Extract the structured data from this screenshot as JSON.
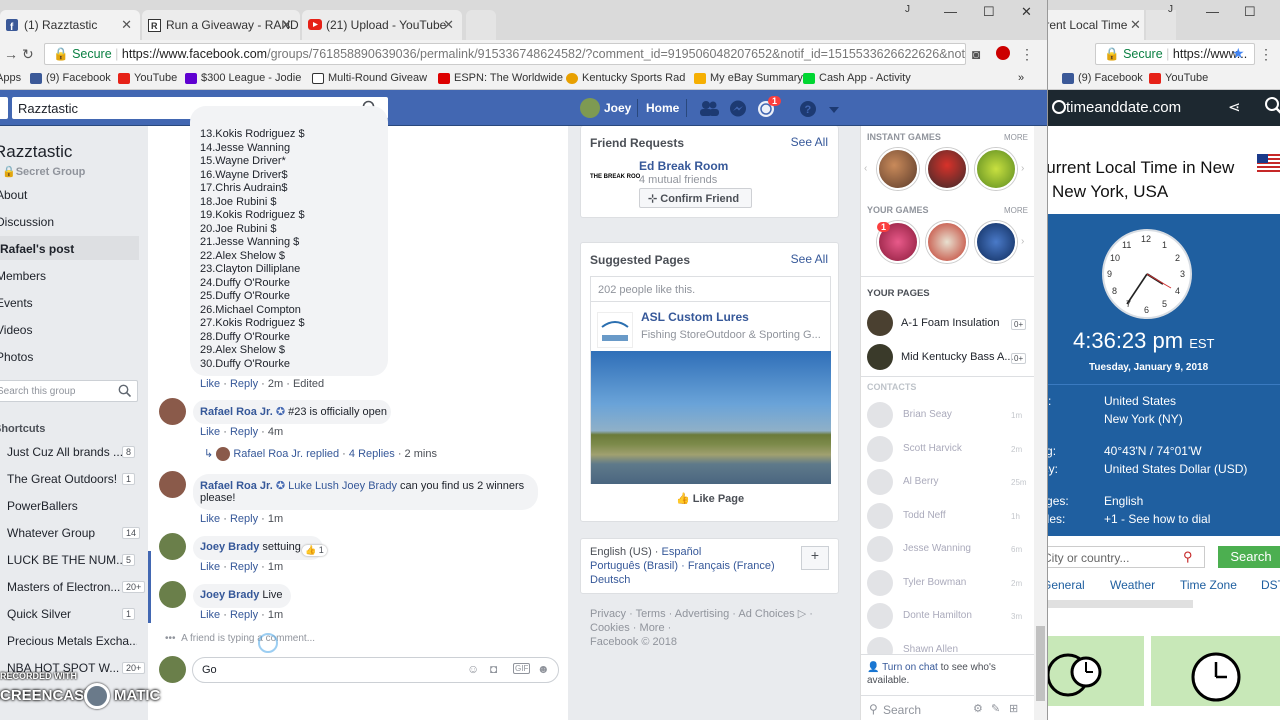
{
  "browser_left": {
    "tabs": [
      {
        "label": "(1) Razztastic",
        "icon": "facebook-icon"
      },
      {
        "label": "Run a Giveaway - RAND",
        "icon": "random-icon"
      },
      {
        "label": "(21) Upload - YouTube",
        "icon": "youtube-icon"
      }
    ],
    "address": {
      "secure_label": "Secure",
      "url_host": "https://www.facebook.com",
      "url_path": "/groups/761858890639036/permalink/915336748624582/?comment_id=919506048207652&notif_id=1515533626622626&notif_..."
    },
    "bookmarks": [
      "Apps",
      "(9) Facebook",
      "YouTube",
      "$300 League - Jodie",
      "Multi-Round Giveaw",
      "ESPN: The Worldwide",
      "Kentucky Sports Rad",
      "My eBay Summary",
      "Cash App - Activity"
    ],
    "more_bookmarks": "»"
  },
  "fb_header": {
    "search_value": "Razztastic",
    "user_name": "Joey",
    "home_label": "Home",
    "notif_count": "1"
  },
  "group_nav": {
    "group_name": "Razztastic",
    "group_type": "Secret Group",
    "items": [
      "About",
      "Discussion",
      "Rafael's post",
      "Members",
      "Events",
      "Videos",
      "Photos"
    ],
    "search_placeholder": "Search this group",
    "shortcuts_label": "Shortcuts",
    "shortcuts": [
      {
        "label": "Just Cuz All brands ...",
        "count": "8"
      },
      {
        "label": "The Great Outdoors!",
        "count": "1"
      },
      {
        "label": "PowerBallers",
        "count": ""
      },
      {
        "label": "Whatever Group",
        "count": "14"
      },
      {
        "label": "LUCK BE THE NUM...",
        "count": "5"
      },
      {
        "label": "Masters of Electron...",
        "count": "20+"
      },
      {
        "label": "Quick Silver",
        "count": "1"
      },
      {
        "label": "Precious Metals Excha...",
        "count": ""
      },
      {
        "label": "NBA HOT SPOT W...",
        "count": "20+"
      }
    ]
  },
  "feed": {
    "list_lines": [
      "13.Kokis Rodriguez $",
      "14.Jesse Wanning",
      "15.Wayne Driver*",
      "16.Wayne Driver$",
      "17.Chris Audrain$",
      "18.Joe Rubini $",
      "19.Kokis Rodriguez $",
      "20.Joe Rubini $",
      "21.Jesse Wanning $",
      "22.Alex Shelow $",
      "23.Clayton Dilliplane",
      "24.Duffy O'Rourke",
      "25.Duffy O'Rourke",
      "26.Michael Compton",
      "27.Kokis Rodriguez $",
      "28.Duffy O'Rourke",
      "29.Alex Shelow $",
      "30.Duffy O'Rourke"
    ],
    "list_meta": {
      "like": "Like",
      "reply": "Reply",
      "time": "2m",
      "edited": "Edited"
    },
    "comments": [
      {
        "name": "Rafael Roa Jr.",
        "text": "#23 is officially open",
        "like": "Like",
        "reply": "Reply",
        "time": "4m"
      },
      {
        "name": "Rafael Roa Jr.",
        "tags": "Luke Lush Joey Brady",
        "text": "can you find us 2 winners please!",
        "like": "Like",
        "reply": "Reply",
        "time": "1m"
      },
      {
        "name": "Joey Brady",
        "text": "settuing",
        "reaction_count": "1",
        "like": "Like",
        "reply": "Reply",
        "time": "1m"
      },
      {
        "name": "Joey Brady",
        "text": "Live",
        "like": "Like",
        "reply": "Reply",
        "time": "1m"
      }
    ],
    "replied_line": {
      "name": "Rafael Roa Jr. replied",
      "replies": "4 Replies",
      "time": "2 mins"
    },
    "typing_text": "A friend is typing a comment...",
    "compose_value": "Go"
  },
  "right_col": {
    "friend_requests": {
      "title": "Friend Requests",
      "see_all": "See All",
      "name": "Ed Break Room",
      "mutual": "4 mutual friends",
      "confirm": "Confirm Friend",
      "logo_text": "THE BREAK ROO"
    },
    "suggested": {
      "title": "Suggested Pages",
      "see_all": "See All",
      "likes": "202 people like this.",
      "page_name": "ASL Custom Lures",
      "page_cat": "Fishing StoreOutdoor & Sporting G...",
      "like_page": "Like Page"
    },
    "languages": {
      "line1a": "English (US)",
      "line1b": "Español",
      "line2a": "Português (Brasil)",
      "line2b": "Français (France)",
      "line3": "Deutsch",
      "plus": "+"
    },
    "footer": {
      "privacy": "Privacy",
      "terms": "Terms",
      "advertising": "Advertising",
      "adchoices": "Ad Choices",
      "cookies": "Cookies",
      "more": "More",
      "copyright": "Facebook © 2018"
    }
  },
  "games": {
    "instant_label": "INSTANT GAMES",
    "your_label": "YOUR GAMES",
    "more_label": "MORE",
    "pages_label": "YOUR PAGES",
    "pages": [
      {
        "name": "A-1 Foam Insulation",
        "count": "0+"
      },
      {
        "name": "Mid Kentucky Bass A...",
        "count": "0+"
      }
    ],
    "contacts_label": "CONTACTS",
    "contacts": [
      {
        "name": "Brian Seay",
        "time": "1m"
      },
      {
        "name": "Scott Harvick",
        "time": "2m"
      },
      {
        "name": "Al Berry",
        "time": "25m"
      },
      {
        "name": "Todd Neff",
        "time": "1h"
      },
      {
        "name": "Jesse Wanning",
        "time": "6m"
      },
      {
        "name": "Tyler Bowman",
        "time": "2m"
      },
      {
        "name": "Donte Hamilton",
        "time": "3m"
      },
      {
        "name": "Shawn Allen",
        "time": ""
      }
    ],
    "chat_link": "Turn on chat",
    "chat_text": " to see who's available.",
    "chat_search": "Search"
  },
  "browser_right": {
    "tab_label": "Current Local Time",
    "secure_label": "Secure",
    "url": "https://www...",
    "bookmarks": [
      "(9) Facebook",
      "YouTube"
    ],
    "brand": "timeanddate.com",
    "heading_line1": "Current Local Time in New",
    "heading_line2": "New York, USA",
    "time": "4:36:23 pm",
    "tz": "EST",
    "date": "Tuesday, January 9, 2018",
    "info": [
      {
        "label": "Country:",
        "value": "United States"
      },
      {
        "label": "",
        "value": "New York (NY)"
      },
      {
        "label": "Lat/Long:",
        "value": "40°43'N / 74°01'W"
      },
      {
        "label": "Currency:",
        "value": "United States Dollar (USD)"
      },
      {
        "label": "Languages:",
        "value": "English"
      },
      {
        "label": "Dial codes:",
        "value": "+1 - See how to dial"
      }
    ],
    "search_placeholder": "City or country...",
    "search_btn": "Search",
    "nav": [
      "General",
      "Weather",
      "Time Zone",
      "DST"
    ]
  },
  "watermark": {
    "line1": "RECORDED WITH",
    "line2": "SCREENCAST",
    "line3": "MATIC"
  },
  "colors": {
    "fb_blue": "#4267b2",
    "link": "#365899",
    "tdd_dark": "#1d2830",
    "tdd_blue": "#1f5fa0",
    "tdd_green": "#4caf50"
  }
}
